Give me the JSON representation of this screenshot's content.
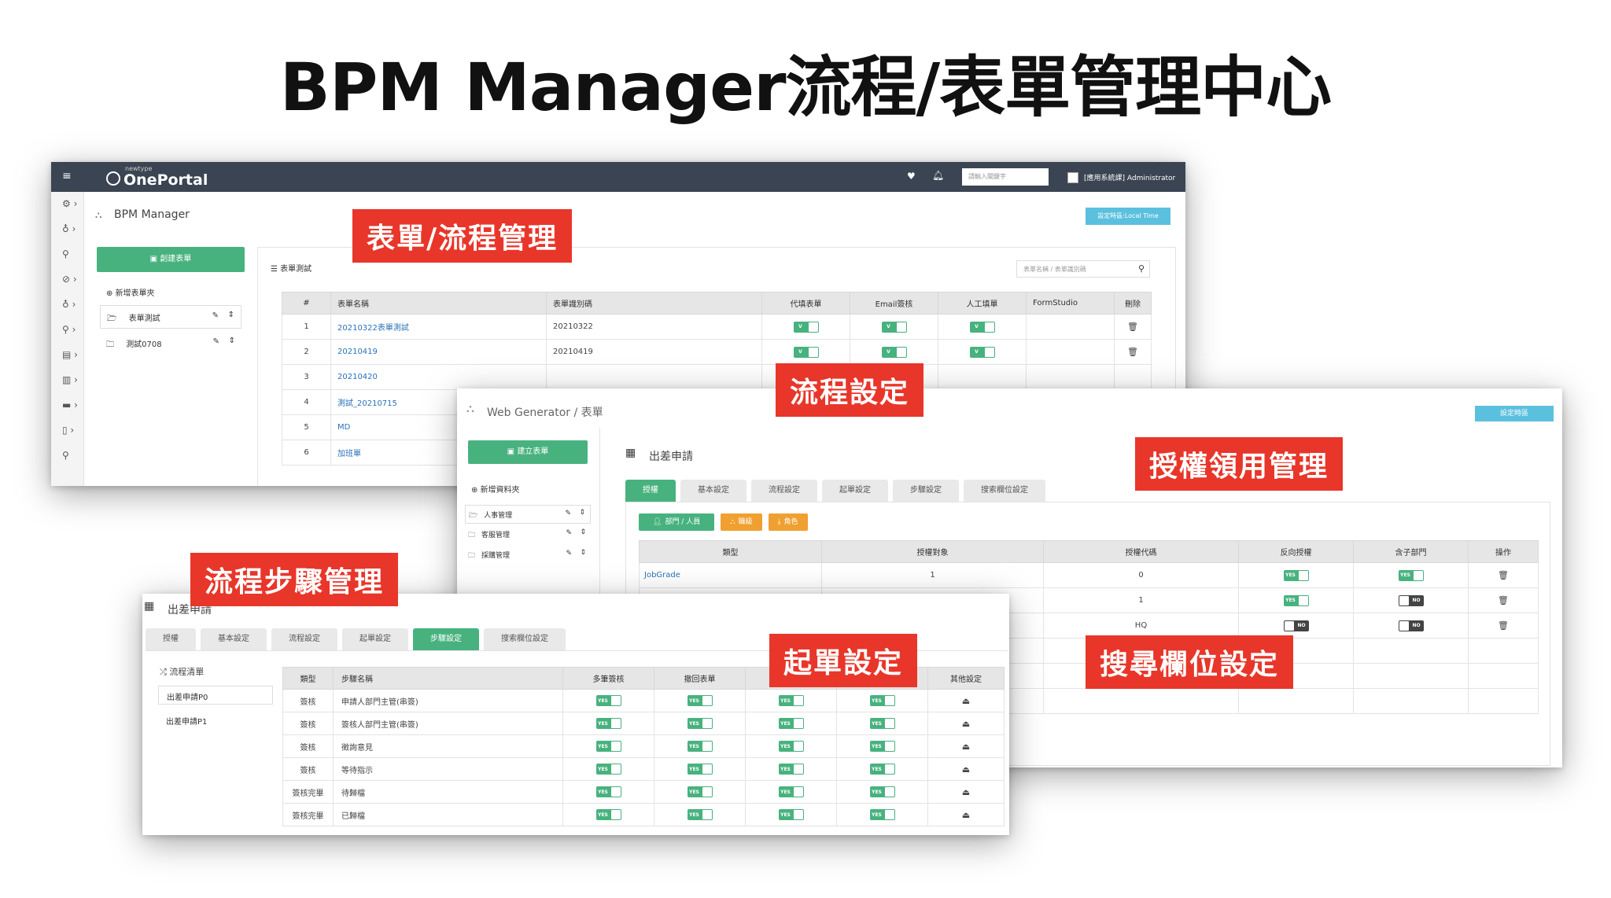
{
  "slide_title": "BPM Manager流程/表單管理中心",
  "callouts": {
    "form_flow": "表單/流程管理",
    "flow_settings": "流程設定",
    "auth_mgmt": "授權領用管理",
    "step_mgmt": "流程步驟管理",
    "start_settings": "起單設定",
    "search_fields": "搜尋欄位設定"
  },
  "shot1": {
    "logo_small": "newtype",
    "logo": "OnePortal",
    "search_placeholder": "請輸入關鍵字",
    "user": "[應用系統課] Administrator",
    "page_title": "BPM Manager",
    "tz_button": "設定時區:Local Time",
    "create_button": "創建表單",
    "new_category": "新增表單夾",
    "folders": [
      "表單測試",
      "測試0708"
    ],
    "panel_title": "表單測試",
    "panel_search_placeholder": "表單名稱 / 表單識別碼",
    "columns": [
      "#",
      "表單名稱",
      "表單識別碼",
      "代填表單",
      "Email簽核",
      "人工填單",
      "FormStudio",
      "刪除"
    ],
    "rows": [
      {
        "num": "1",
        "name": "20210322表單測試",
        "id": "20210322"
      },
      {
        "num": "2",
        "name": "20210419",
        "id": "20210419"
      },
      {
        "num": "3",
        "name": "20210420",
        "id": ""
      },
      {
        "num": "4",
        "name": "測試_20210715",
        "id": ""
      },
      {
        "num": "5",
        "name": "MD",
        "id": ""
      },
      {
        "num": "6",
        "name": "加班單",
        "id": ""
      }
    ]
  },
  "shot2": {
    "breadcrumb": "Web Generator / 表單",
    "tz_button": "設定時區",
    "create_button": "建立表單",
    "new_category": "新增資料夾",
    "folders": [
      "人事管理",
      "客服管理",
      "採購管理"
    ],
    "form_title": "出差申請",
    "tabs": [
      "授權",
      "基本設定",
      "流程設定",
      "起單設定",
      "步驟設定",
      "搜索欄位設定"
    ],
    "buttons": [
      "部門 / 人員",
      "職級",
      "角色"
    ],
    "columns": [
      "類型",
      "授權對象",
      "授權代碼",
      "反向授權",
      "含子部門",
      "操作"
    ],
    "rows": [
      {
        "type": "JobGrade",
        "target": "1",
        "code": "0"
      },
      {
        "type": "",
        "target": "",
        "code": "1"
      },
      {
        "type": "",
        "target": "",
        "code": "HQ"
      }
    ]
  },
  "shot3": {
    "form_title": "出差申請",
    "tabs": [
      "授權",
      "基本設定",
      "流程設定",
      "起單設定",
      "步驟設定",
      "搜索欄位設定"
    ],
    "flow_list_title": "流程清單",
    "flows": [
      "出差申請P0",
      "出差申請P1"
    ],
    "columns": [
      "類型",
      "步驟名稱",
      "多筆簽核",
      "撤回表單",
      "",
      "",
      "其他設定"
    ],
    "rows": [
      {
        "type": "簽核",
        "name": "申請人部門主管(串簽)"
      },
      {
        "type": "簽核",
        "name": "簽核人部門主管(串簽)"
      },
      {
        "type": "簽核",
        "name": "徵詢意見"
      },
      {
        "type": "簽核",
        "name": "等待指示"
      },
      {
        "type": "簽核完畢",
        "name": "待歸檔"
      },
      {
        "type": "簽核完畢",
        "name": "已歸檔"
      }
    ]
  },
  "toggle": {
    "on": "YES",
    "off": "NO",
    "v": "V"
  },
  "colors": {
    "accent_green": "#48b27f",
    "callout_red": "#e8362a",
    "topbar": "#3b4452",
    "orange": "#f0a030",
    "blue_btn": "#5bc0de"
  }
}
